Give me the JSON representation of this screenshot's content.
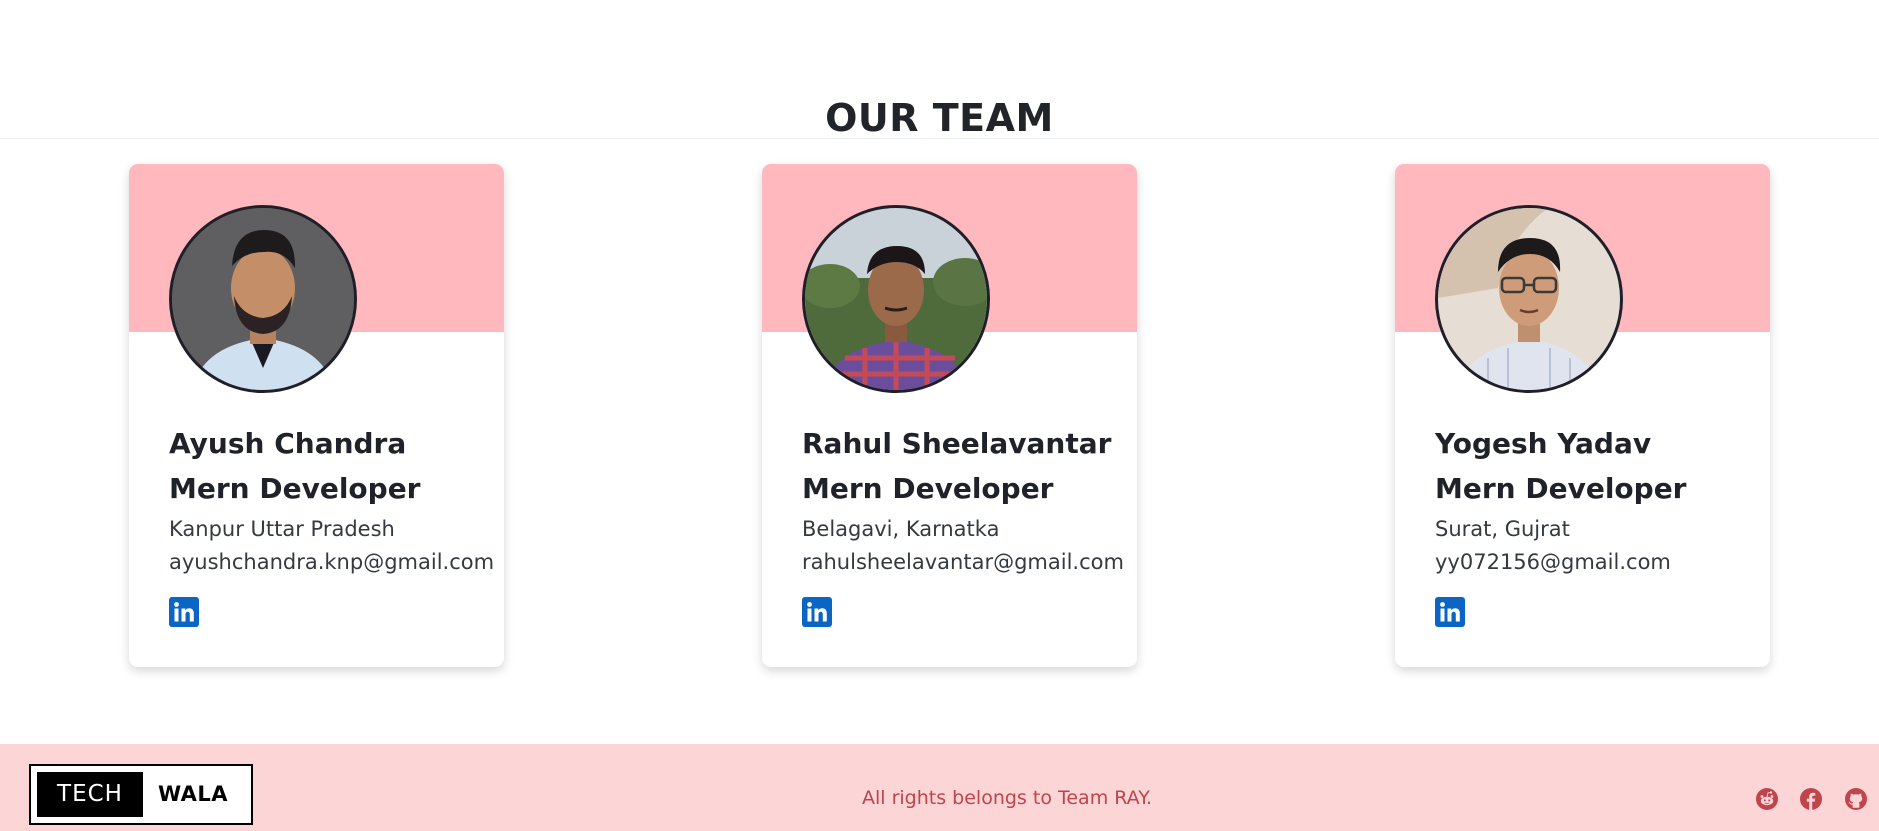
{
  "section": {
    "title": "OUR TEAM"
  },
  "team": [
    {
      "name": "Ayush Chandra",
      "role": "Mern Developer",
      "location": "Kanpur Uttar Pradesh",
      "email": "ayushchandra.knp@gmail.com"
    },
    {
      "name": "Rahul Sheelavantar",
      "role": "Mern Developer",
      "location": "Belagavi, Karnatka",
      "email": "rahulsheelavantar@gmail.com"
    },
    {
      "name": "Yogesh Yadav",
      "role": "Mern Developer",
      "location": "Surat, Gujrat",
      "email": "yy072156@gmail.com"
    }
  ],
  "footer": {
    "logo": {
      "part1": "TECH",
      "part2": "WALA"
    },
    "copyright": "All rights belongs to Team RAY.",
    "social_icons": [
      "reddit-icon",
      "facebook-icon",
      "github-icon"
    ]
  },
  "colors": {
    "card_band": "#ffb8bd",
    "footer_bg": "#fcd5d7",
    "footer_text": "#c0444c",
    "linkedin": "#0a66c2"
  }
}
